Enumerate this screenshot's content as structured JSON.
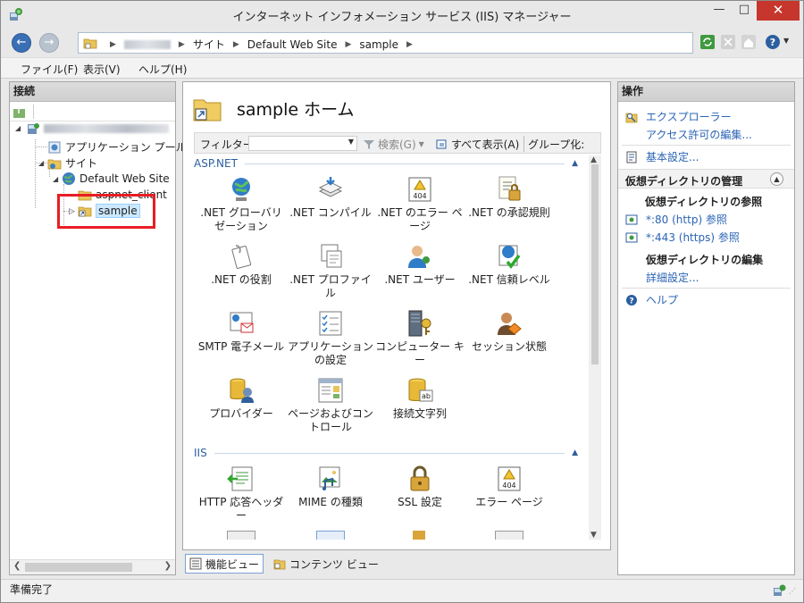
{
  "window": {
    "title": "インターネット インフォメーション サービス (IIS) マネージャー"
  },
  "address": {
    "crumbs": [
      "サイト",
      "Default Web Site",
      "sample"
    ]
  },
  "menu": {
    "file": "ファイル(F)",
    "view": "表示(V)",
    "help": "ヘルプ(H)"
  },
  "connections": {
    "header": "接続",
    "app_pools": "アプリケーション プール",
    "sites": "サイト",
    "default_site": "Default Web Site",
    "aspnet_client": "aspnet_client",
    "sample": "sample"
  },
  "center": {
    "title": "sample ホーム",
    "filter_label": "フィルター:",
    "search": "検索(G)",
    "show_all": "すべて表示(A)",
    "group_by": "グループ化:",
    "section_aspnet": "ASP.NET",
    "section_iis": "IIS",
    "aspnet_features": [
      ".NET グローバリゼーション",
      ".NET コンパイル",
      ".NET のエラー ページ",
      ".NET の承認規則",
      ".NET の役割",
      ".NET プロファイル",
      ".NET ユーザー",
      ".NET 信頼レベル",
      "SMTP 電子メール",
      "アプリケーションの設定",
      "コンピューター キー",
      "セッション状態",
      "プロバイダー",
      "ページおよびコントロール",
      "接続文字列"
    ],
    "iis_features": [
      "HTTP 応答ヘッダー",
      "MIME の種類",
      "SSL 設定",
      "エラー ページ"
    ],
    "icon_404": "404",
    "view_features": "機能ビュー",
    "view_content": "コンテンツ ビュー"
  },
  "actions": {
    "header": "操作",
    "explore": "エクスプローラー",
    "edit_permissions": "アクセス許可の編集...",
    "basic_settings": "基本設定...",
    "vdir_manage": "仮想ディレクトリの管理",
    "vdir_browse": "仮想ディレクトリの参照",
    "browse_80": "*:80 (http) 参照",
    "browse_443": "*:443 (https) 参照",
    "vdir_edit": "仮想ディレクトリの編集",
    "advanced_settings": "詳細設定...",
    "help": "ヘルプ"
  },
  "status": {
    "text": "準備完了"
  },
  "colors": {
    "accent": "#2a64b4",
    "highlight": "#e81d25",
    "selection": "#cce8ff"
  }
}
